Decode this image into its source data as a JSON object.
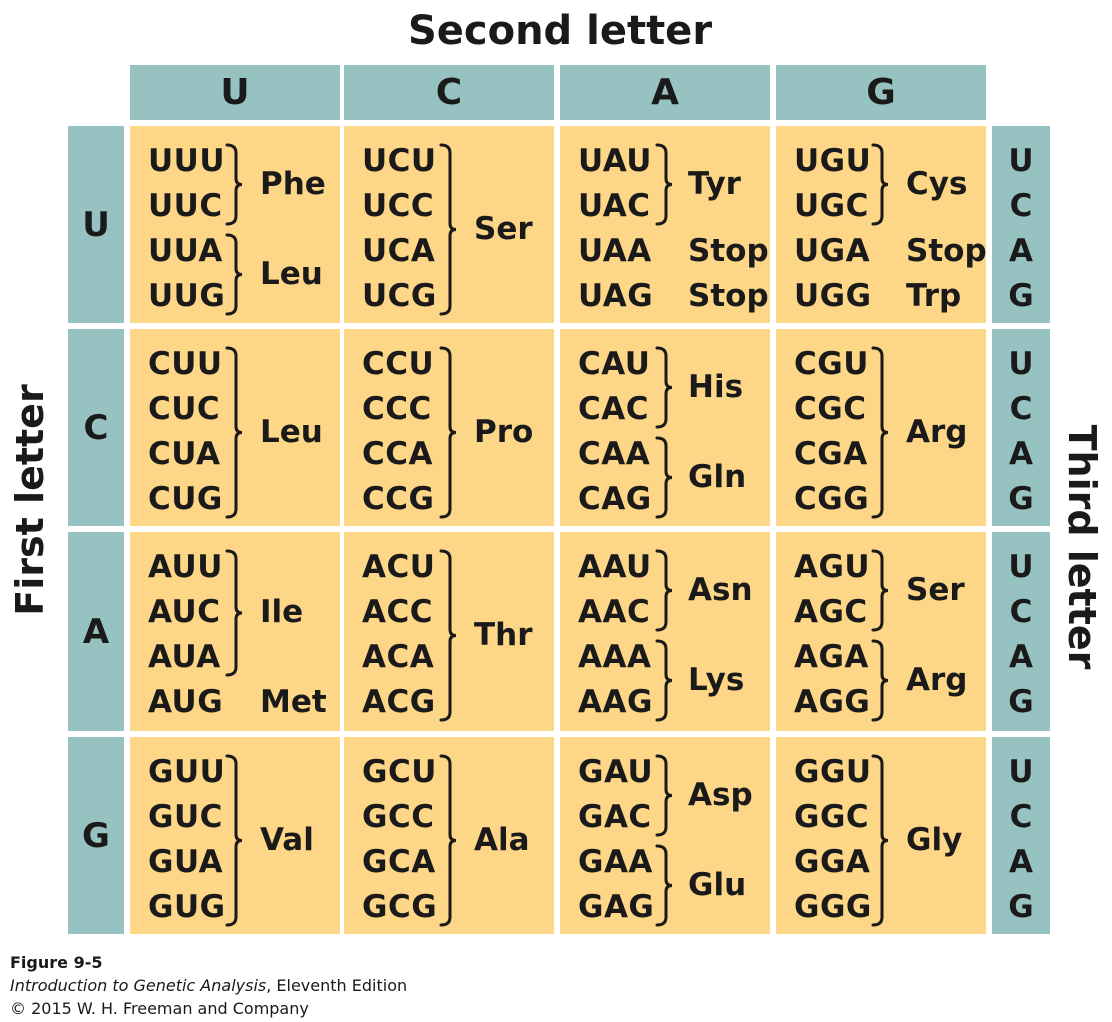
{
  "titles": {
    "second": "Second letter",
    "first": "First letter",
    "third": "Third letter"
  },
  "second_letters": [
    "U",
    "C",
    "A",
    "G"
  ],
  "first_letters": [
    "U",
    "C",
    "A",
    "G"
  ],
  "third_letters": [
    "U",
    "C",
    "A",
    "G"
  ],
  "cells": [
    [
      {
        "codons": [
          "UUU",
          "UUC",
          "UUA",
          "UUG"
        ],
        "groups": [
          {
            "aa": "Phe",
            "from": 0,
            "to": 1
          },
          {
            "aa": "Leu",
            "from": 2,
            "to": 3
          }
        ]
      },
      {
        "codons": [
          "UCU",
          "UCC",
          "UCA",
          "UCG"
        ],
        "groups": [
          {
            "aa": "Ser",
            "from": 0,
            "to": 3
          }
        ]
      },
      {
        "codons": [
          "UAU",
          "UAC",
          "UAA",
          "UAG"
        ],
        "groups": [
          {
            "aa": "Tyr",
            "from": 0,
            "to": 1
          },
          {
            "aa": "Stop",
            "from": 2,
            "to": 2
          },
          {
            "aa": "Stop",
            "from": 3,
            "to": 3
          }
        ]
      },
      {
        "codons": [
          "UGU",
          "UGC",
          "UGA",
          "UGG"
        ],
        "groups": [
          {
            "aa": "Cys",
            "from": 0,
            "to": 1
          },
          {
            "aa": "Stop",
            "from": 2,
            "to": 2
          },
          {
            "aa": "Trp",
            "from": 3,
            "to": 3
          }
        ]
      }
    ],
    [
      {
        "codons": [
          "CUU",
          "CUC",
          "CUA",
          "CUG"
        ],
        "groups": [
          {
            "aa": "Leu",
            "from": 0,
            "to": 3
          }
        ]
      },
      {
        "codons": [
          "CCU",
          "CCC",
          "CCA",
          "CCG"
        ],
        "groups": [
          {
            "aa": "Pro",
            "from": 0,
            "to": 3
          }
        ]
      },
      {
        "codons": [
          "CAU",
          "CAC",
          "CAA",
          "CAG"
        ],
        "groups": [
          {
            "aa": "His",
            "from": 0,
            "to": 1
          },
          {
            "aa": "Gln",
            "from": 2,
            "to": 3
          }
        ]
      },
      {
        "codons": [
          "CGU",
          "CGC",
          "CGA",
          "CGG"
        ],
        "groups": [
          {
            "aa": "Arg",
            "from": 0,
            "to": 3
          }
        ]
      }
    ],
    [
      {
        "codons": [
          "AUU",
          "AUC",
          "AUA",
          "AUG"
        ],
        "groups": [
          {
            "aa": "Ile",
            "from": 0,
            "to": 2
          },
          {
            "aa": "Met",
            "from": 3,
            "to": 3
          }
        ]
      },
      {
        "codons": [
          "ACU",
          "ACC",
          "ACA",
          "ACG"
        ],
        "groups": [
          {
            "aa": "Thr",
            "from": 0,
            "to": 3
          }
        ]
      },
      {
        "codons": [
          "AAU",
          "AAC",
          "AAA",
          "AAG"
        ],
        "groups": [
          {
            "aa": "Asn",
            "from": 0,
            "to": 1
          },
          {
            "aa": "Lys",
            "from": 2,
            "to": 3
          }
        ]
      },
      {
        "codons": [
          "AGU",
          "AGC",
          "AGA",
          "AGG"
        ],
        "groups": [
          {
            "aa": "Ser",
            "from": 0,
            "to": 1
          },
          {
            "aa": "Arg",
            "from": 2,
            "to": 3
          }
        ]
      }
    ],
    [
      {
        "codons": [
          "GUU",
          "GUC",
          "GUA",
          "GUG"
        ],
        "groups": [
          {
            "aa": "Val",
            "from": 0,
            "to": 3
          }
        ]
      },
      {
        "codons": [
          "GCU",
          "GCC",
          "GCA",
          "GCG"
        ],
        "groups": [
          {
            "aa": "Ala",
            "from": 0,
            "to": 3
          }
        ]
      },
      {
        "codons": [
          "GAU",
          "GAC",
          "GAA",
          "GAG"
        ],
        "groups": [
          {
            "aa": "Asp",
            "from": 0,
            "to": 1
          },
          {
            "aa": "Glu",
            "from": 2,
            "to": 3
          }
        ]
      },
      {
        "codons": [
          "GGU",
          "GGC",
          "GGA",
          "GGG"
        ],
        "groups": [
          {
            "aa": "Gly",
            "from": 0,
            "to": 3
          }
        ]
      }
    ]
  ],
  "caption": {
    "figure": "Figure 9-5",
    "book_title": "Introduction to Genetic Analysis",
    "edition": ", Eleventh Edition",
    "copyright": "© 2015 W. H. Freeman and Company"
  },
  "colors": {
    "header_teal": "#96c3c1",
    "cell_yellow": "#fdd687",
    "text": "#1a1a1a",
    "background": "#ffffff"
  }
}
